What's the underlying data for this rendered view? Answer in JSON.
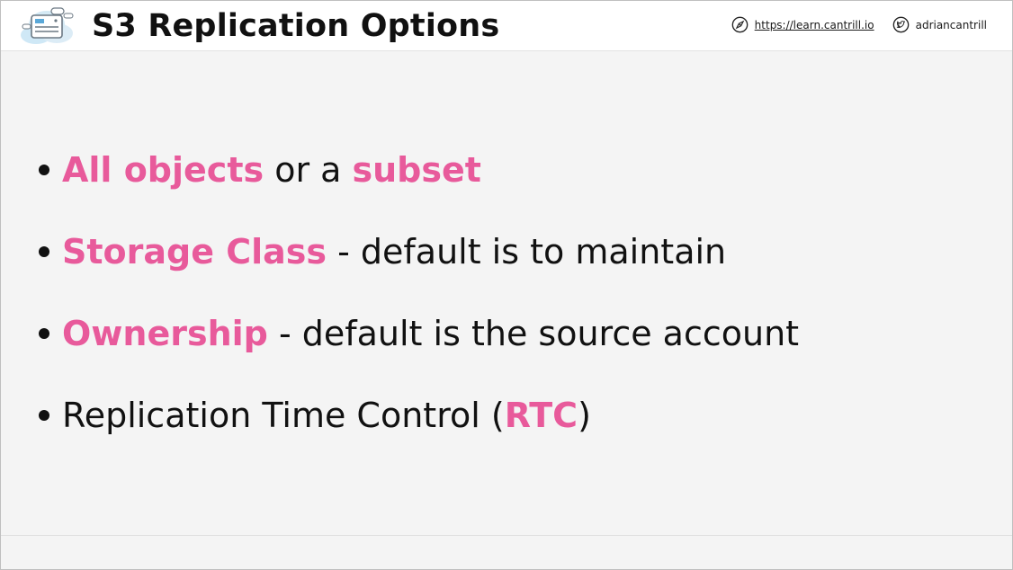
{
  "header": {
    "title": "S3 Replication Options",
    "website": "https://learn.cantrill.io",
    "twitter": "adriancantrill",
    "website_icon": "compass-icon",
    "twitter_icon": "twitter-bird-icon",
    "logo_icon": "cloud-server-logo"
  },
  "bullets": [
    {
      "highlight": "All objects",
      "middle": " or a ",
      "highlight2": "subset"
    },
    {
      "highlight": "Storage Class",
      "rest": " - default is to maintain"
    },
    {
      "highlight": "Ownership",
      "rest": " - default is the source account"
    },
    {
      "prefix": "Replication Time Control (",
      "highlight": "RTC",
      "suffix": ")"
    }
  ],
  "colors": {
    "accent": "#e85a9b",
    "text": "#111111",
    "background": "#f4f4f4"
  }
}
